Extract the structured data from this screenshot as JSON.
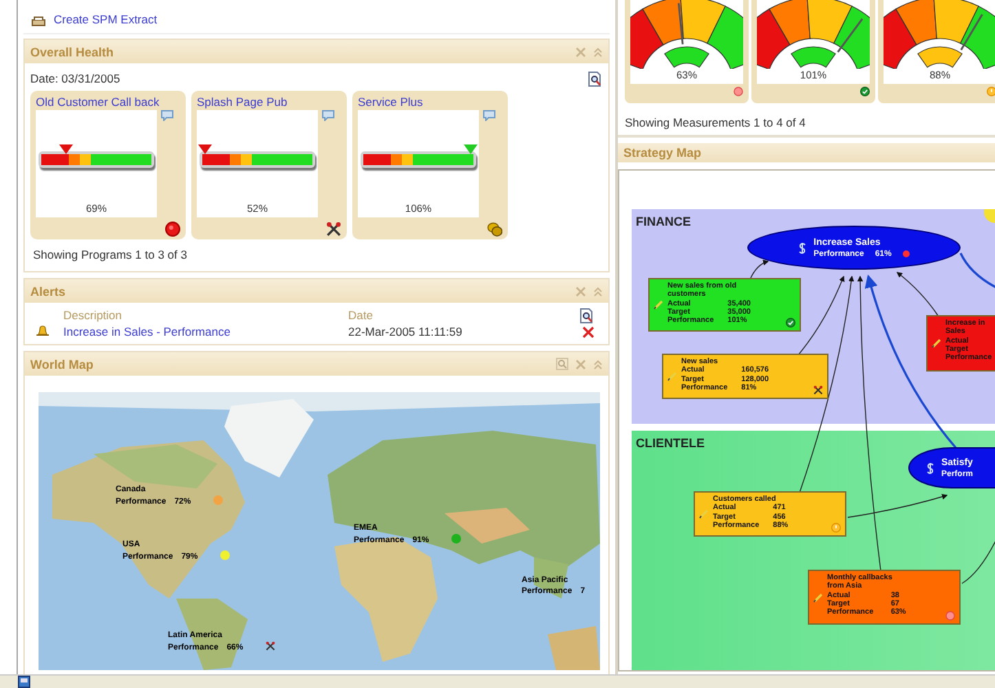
{
  "extract_link": {
    "label": "Create SPM Extract"
  },
  "overall_health": {
    "title": "Overall Health",
    "date": "Date: 03/31/2005",
    "programs": [
      {
        "name": "Old Customer Call back",
        "level": 0.22,
        "value": "69%",
        "kind": "critical"
      },
      {
        "name": "Splash Page Pub",
        "level": 0.03,
        "value": "52%",
        "kind": "tools"
      },
      {
        "name": "Service Plus",
        "level": 0.97,
        "value": "106%",
        "kind": "coins"
      }
    ],
    "footer": "Showing Programs 1 to 3 of 3"
  },
  "alerts": {
    "title": "Alerts",
    "columns": [
      "Description",
      "Date"
    ],
    "rows": [
      {
        "description": "Increase in Sales - Performance",
        "date": "22-Mar-2005 11:11:59"
      }
    ]
  },
  "world_map": {
    "title": "World Map",
    "regions": [
      {
        "name": "Canada",
        "metric": "Performance",
        "value": "72%",
        "kind": "dot",
        "color": "#f2a444"
      },
      {
        "name": "USA",
        "metric": "Performance",
        "value": "79%",
        "kind": "dot",
        "color": "#eef030"
      },
      {
        "name": "EMEA",
        "metric": "Performance",
        "value": "91%",
        "kind": "dot",
        "color": "#1fb21f"
      },
      {
        "name": "Asia Pacific",
        "metric": "Performance",
        "value": "7",
        "kind": "plain"
      },
      {
        "name": "Latin America",
        "metric": "Performance",
        "value": "66%",
        "kind": "tools"
      }
    ]
  },
  "measurements": {
    "gauges": [
      {
        "value": "63%",
        "color": "#22dd22",
        "kind": "critical"
      },
      {
        "value": "101%",
        "color": "#22dd22",
        "kind": "ok"
      },
      {
        "value": "88%",
        "color": "#ffc20e",
        "kind": "warning"
      }
    ],
    "footer": "Showing Measurements 1 to 4 of 4"
  },
  "strategy_map": {
    "title": "Strategy Map",
    "perspectives": [
      {
        "name": "FINANCE",
        "nodes": [
          {
            "kind": "objective",
            "title": "Increase Sales",
            "metric": "Performance",
            "value": "61%",
            "indicator": {
              "kind": "critical"
            }
          },
          {
            "kind": "measure",
            "color": "#22e022",
            "title": "New sales from old customers",
            "rows": [
              {
                "label": "Actual",
                "value": "35,400"
              },
              {
                "label": "Target",
                "value": "35,000"
              },
              {
                "label": "Performance",
                "value": "101%"
              }
            ],
            "indicator": {
              "kind": "ok"
            }
          },
          {
            "kind": "measure",
            "color": "#fbc21a",
            "title": "New sales",
            "rows": [
              {
                "label": "Actual",
                "value": "160,576"
              },
              {
                "label": "Target",
                "value": "128,000"
              },
              {
                "label": "Performance",
                "value": "81%"
              }
            ],
            "indicator": {
              "kind": "tools"
            }
          },
          {
            "kind": "measure",
            "color": "#ee1111",
            "title": "Increase in Sales",
            "rows": [
              {
                "label": "Actual"
              },
              {
                "label": "Target"
              },
              {
                "label": "Performance"
              }
            ]
          }
        ]
      },
      {
        "name": "CLIENTELE",
        "nodes": [
          {
            "kind": "objective",
            "title": "Satisfy",
            "metric": "Perform"
          },
          {
            "kind": "measure",
            "color": "#fbc21a",
            "title": "Customers called",
            "rows": [
              {
                "label": "Actual",
                "value": "471"
              },
              {
                "label": "Target",
                "value": "456"
              },
              {
                "label": "Performance",
                "value": "88%"
              }
            ],
            "indicator": {
              "kind": "warning"
            }
          },
          {
            "kind": "measure",
            "color": "#ff6a00",
            "title": "Monthly callbacks from Asia",
            "rows": [
              {
                "label": "Actual",
                "value": "38"
              },
              {
                "label": "Target",
                "value": "67"
              },
              {
                "label": "Performance",
                "value": "63%"
              }
            ],
            "indicator": {
              "kind": "critical"
            }
          }
        ]
      }
    ]
  }
}
